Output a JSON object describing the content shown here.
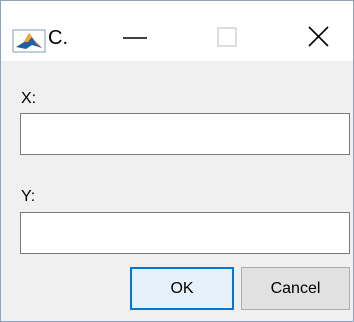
{
  "window": {
    "title": "C.",
    "controls": {
      "minimize_icon": "minimize-icon",
      "maximize_icon": "maximize-icon",
      "close_icon": "close-icon"
    },
    "app_icon": "matlab-icon"
  },
  "form": {
    "x_label": "X:",
    "x_value": "",
    "y_label": "Y:",
    "y_value": ""
  },
  "buttons": {
    "ok_label": "OK",
    "cancel_label": "Cancel"
  },
  "colors": {
    "accent": "#0078d7",
    "ok_button_bg": "#e5f1fb",
    "cancel_button_bg": "#e1e1e1",
    "dialog_bg": "#f0f0f0"
  }
}
